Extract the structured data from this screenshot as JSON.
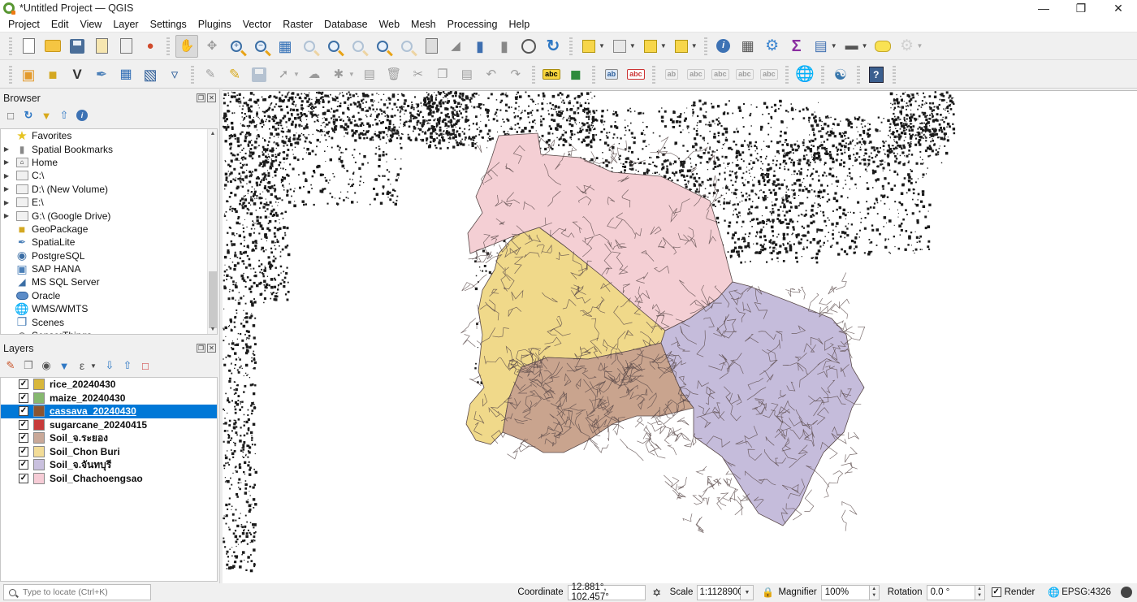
{
  "window": {
    "title": "*Untitled Project — QGIS",
    "controls": [
      "minimize",
      "restore",
      "close"
    ]
  },
  "menubar": [
    "Project",
    "Edit",
    "View",
    "Layer",
    "Settings",
    "Plugins",
    "Vector",
    "Raster",
    "Database",
    "Web",
    "Mesh",
    "Processing",
    "Help"
  ],
  "toolbars": {
    "row1": [
      {
        "icon": "new-project-icon",
        "enabled": true
      },
      {
        "icon": "open-project-icon",
        "enabled": true
      },
      {
        "icon": "save-project-icon",
        "enabled": true
      },
      {
        "icon": "new-print-layout-icon",
        "enabled": true
      },
      {
        "icon": "layout-manager-icon",
        "enabled": true
      },
      {
        "icon": "style-manager-icon",
        "enabled": true
      },
      {
        "icon": "pan-map-icon",
        "enabled": true,
        "active": true
      },
      {
        "icon": "pan-to-selection-icon",
        "enabled": false
      },
      {
        "icon": "zoom-in-icon",
        "enabled": true
      },
      {
        "icon": "zoom-out-icon",
        "enabled": true
      },
      {
        "icon": "zoom-full-icon",
        "enabled": true
      },
      {
        "icon": "zoom-to-selection-icon",
        "enabled": false
      },
      {
        "icon": "zoom-to-layer-icon",
        "enabled": true
      },
      {
        "icon": "zoom-native-icon",
        "enabled": false
      },
      {
        "icon": "zoom-last-icon",
        "enabled": true
      },
      {
        "icon": "zoom-next-icon",
        "enabled": false
      },
      {
        "icon": "new-map-view-icon",
        "enabled": true
      },
      {
        "icon": "new-3d-map-view-icon",
        "enabled": true
      },
      {
        "icon": "new-bookmark-icon",
        "enabled": true
      },
      {
        "icon": "show-bookmarks-icon",
        "enabled": true
      },
      {
        "icon": "temporal-controller-icon",
        "enabled": true
      },
      {
        "icon": "refresh-icon",
        "enabled": true
      },
      {
        "icon": "select-features-icon",
        "enabled": true,
        "dropdown": true
      },
      {
        "icon": "select-by-attribute-icon",
        "enabled": true,
        "dropdown": true
      },
      {
        "icon": "deselect-features-icon",
        "enabled": true,
        "dropdown": true
      },
      {
        "icon": "select-by-location-icon",
        "enabled": true,
        "dropdown": true
      },
      {
        "icon": "identify-features-icon",
        "enabled": true
      },
      {
        "icon": "open-field-calculator-icon",
        "enabled": true
      },
      {
        "icon": "processing-toolbox-icon",
        "enabled": true
      },
      {
        "icon": "statistical-summary-icon",
        "enabled": true
      },
      {
        "icon": "open-attribute-table-icon",
        "enabled": true,
        "dropdown": true
      },
      {
        "icon": "measure-line-icon",
        "enabled": true,
        "dropdown": true
      },
      {
        "icon": "map-tips-icon",
        "enabled": true
      },
      {
        "icon": "locator-settings-icon",
        "enabled": false,
        "dropdown": true
      }
    ],
    "row2": [
      {
        "icon": "data-source-manager-icon",
        "enabled": true
      },
      {
        "icon": "new-geopackage-layer-icon",
        "enabled": true
      },
      {
        "icon": "new-shapefile-layer-icon",
        "enabled": true
      },
      {
        "icon": "new-spatialite-layer-icon",
        "enabled": true
      },
      {
        "icon": "new-temporary-layer-icon",
        "enabled": true
      },
      {
        "icon": "new-virtual-layer-icon",
        "enabled": true
      },
      {
        "icon": "new-mesh-layer-icon",
        "enabled": true
      },
      {
        "icon": "edit-pencil-disabled-icon",
        "enabled": false
      },
      {
        "icon": "toggle-editing-icon",
        "enabled": true
      },
      {
        "icon": "save-edits-icon",
        "enabled": false
      },
      {
        "icon": "digitize-icon",
        "enabled": false,
        "dropdown": true
      },
      {
        "icon": "add-polygon-icon",
        "enabled": false
      },
      {
        "icon": "vertex-tool-icon",
        "enabled": false,
        "dropdown": true
      },
      {
        "icon": "modify-attributes-icon",
        "enabled": false
      },
      {
        "icon": "delete-selected-icon",
        "enabled": false
      },
      {
        "icon": "cut-features-icon",
        "enabled": false
      },
      {
        "icon": "copy-features-icon",
        "enabled": false
      },
      {
        "icon": "paste-features-icon",
        "enabled": false
      },
      {
        "icon": "undo-icon",
        "enabled": false
      },
      {
        "icon": "redo-icon",
        "enabled": false
      },
      {
        "icon": "layer-labeling-icon",
        "enabled": true
      },
      {
        "icon": "diagram-options-icon",
        "enabled": true
      },
      {
        "icon": "pin-labels-icon",
        "enabled": true
      },
      {
        "icon": "highlight-pinned-labels-icon",
        "enabled": true
      },
      {
        "icon": "pin-unpin-label-icon",
        "enabled": false
      },
      {
        "icon": "show-hide-labels-icon",
        "enabled": false
      },
      {
        "icon": "move-label-icon",
        "enabled": false
      },
      {
        "icon": "rotate-label-icon",
        "enabled": false
      },
      {
        "icon": "change-label-icon",
        "enabled": false
      },
      {
        "icon": "metasearch-icon",
        "enabled": true
      },
      {
        "icon": "python-console-icon",
        "enabled": true
      },
      {
        "icon": "help-icon",
        "enabled": true
      }
    ]
  },
  "browser": {
    "title": "Browser",
    "tools": [
      "add-selected-layers-icon",
      "refresh-icon",
      "filter-browser-icon",
      "collapse-all-icon",
      "properties-icon"
    ],
    "items": [
      {
        "label": "Favorites",
        "icon": "star-icon",
        "expandable": false
      },
      {
        "label": "Spatial Bookmarks",
        "icon": "bookmark-icon",
        "expandable": true
      },
      {
        "label": "Home",
        "icon": "home-folder-icon",
        "expandable": true
      },
      {
        "label": "C:\\",
        "icon": "folder-icon",
        "expandable": true
      },
      {
        "label": "D:\\ (New Volume)",
        "icon": "folder-icon",
        "expandable": true
      },
      {
        "label": "E:\\",
        "icon": "folder-icon",
        "expandable": true
      },
      {
        "label": "G:\\ (Google Drive)",
        "icon": "folder-icon",
        "expandable": true
      },
      {
        "label": "GeoPackage",
        "icon": "geopackage-icon",
        "expandable": false
      },
      {
        "label": "SpatiaLite",
        "icon": "spatialite-icon",
        "expandable": false
      },
      {
        "label": "PostgreSQL",
        "icon": "postgresql-icon",
        "expandable": false
      },
      {
        "label": "SAP HANA",
        "icon": "sap-hana-icon",
        "expandable": false
      },
      {
        "label": "MS SQL Server",
        "icon": "mssql-icon",
        "expandable": false
      },
      {
        "label": "Oracle",
        "icon": "oracle-icon",
        "expandable": false
      },
      {
        "label": "WMS/WMTS",
        "icon": "wms-icon",
        "expandable": false
      },
      {
        "label": "Scenes",
        "icon": "scenes-icon",
        "expandable": false
      },
      {
        "label": "SensorThings",
        "icon": "sensorthings-icon",
        "expandable": false
      }
    ]
  },
  "layers": {
    "title": "Layers",
    "tools": [
      "open-layer-styling-icon",
      "add-group-icon",
      "manage-map-themes-icon",
      "filter-legend-icon",
      "filter-by-expression-icon",
      "expand-all-icon",
      "collapse-all-icon",
      "remove-layer-icon"
    ],
    "items": [
      {
        "name": "rice_20240430",
        "checked": true,
        "color": "#d8b73c",
        "selected": false
      },
      {
        "name": "maize_20240430",
        "checked": true,
        "color": "#86b86f",
        "selected": false
      },
      {
        "name": "cassava_20240430",
        "checked": true,
        "color": "#8b5531",
        "selected": true
      },
      {
        "name": "sugarcane_20240415",
        "checked": true,
        "color": "#c73a3a",
        "selected": false
      },
      {
        "name": "Soil_จ.ระยอง",
        "checked": true,
        "color": "#c9a898",
        "selected": false
      },
      {
        "name": "Soil_Chon Buri",
        "checked": true,
        "color": "#f2dc97",
        "selected": false
      },
      {
        "name": "Soil_จ.จันทบุรี",
        "checked": true,
        "color": "#c9c0de",
        "selected": false
      },
      {
        "name": "Soil_Chachoengsao",
        "checked": true,
        "color": "#f6ccd6",
        "selected": false
      }
    ]
  },
  "map": {
    "regions": [
      {
        "name": "Soil_Chachoengsao",
        "fill": "#f4cfd4"
      },
      {
        "name": "Soil_Chon Buri",
        "fill": "#f0d98a"
      },
      {
        "name": "Soil_จ.ระยอง",
        "fill": "#c9a48e"
      },
      {
        "name": "Soil_จ.จันทบุรี",
        "fill": "#c5bcdb"
      }
    ],
    "crop_point_color": "#1a1a1a",
    "boundary_color": "#5a4a4a"
  },
  "statusbar": {
    "locator_placeholder": "Type to locate (Ctrl+K)",
    "coordinate_label": "Coordinate",
    "coordinate_value": "12.881°, 102.457°",
    "scale_label": "Scale",
    "scale_value": "1:1128900",
    "magnifier_label": "Magnifier",
    "magnifier_value": "100%",
    "rotation_label": "Rotation",
    "rotation_value": "0.0 °",
    "render_label": "Render",
    "render_checked": true,
    "crs": "EPSG:4326"
  }
}
